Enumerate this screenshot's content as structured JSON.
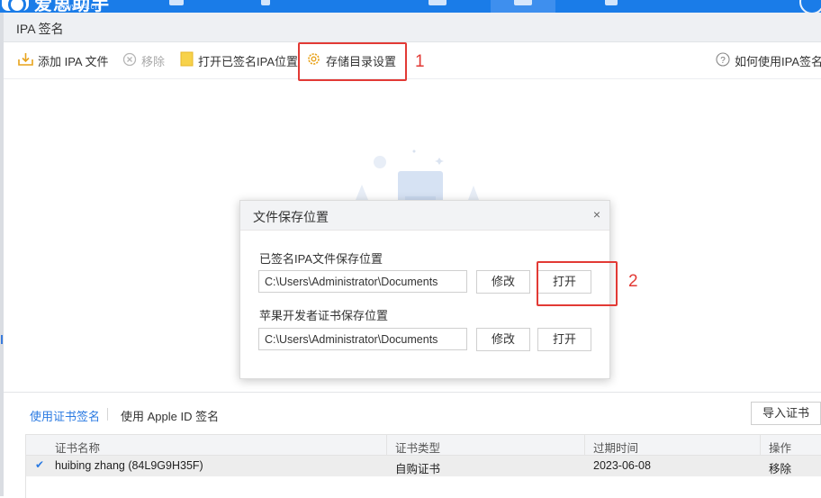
{
  "app": {
    "logo_text": "爱思助手",
    "logo_url": "www.i4.cn",
    "window_title": "IPA 签名"
  },
  "toolbar": {
    "add_ipa": "添加 IPA 文件",
    "remove": "移除",
    "open_signed": "打开已签名IPA位置",
    "storage_settings": "存储目录设置",
    "help": "如何使用IPA签名?"
  },
  "annotations": {
    "marker_1": "1",
    "marker_2": "2"
  },
  "dialog": {
    "title": "文件保存位置",
    "close": "×",
    "signed_ipa": {
      "label": "已签名IPA文件保存位置",
      "path": "C:\\Users\\Administrator\\Documents",
      "modify": "修改",
      "open": "打开"
    },
    "dev_cert": {
      "label": "苹果开发者证书保存位置",
      "path": "C:\\Users\\Administrator\\Documents",
      "modify": "修改",
      "open": "打开"
    }
  },
  "bottom": {
    "tab_cert": "使用证书签名",
    "tab_appleid": "使用 Apple ID 签名",
    "import_cert": "导入证书",
    "columns": [
      "证书名称",
      "证书类型",
      "过期时间",
      "操作"
    ],
    "rows": [
      {
        "checked": true,
        "name": "huibing zhang (84L9G9H35F)",
        "type": "自购证书",
        "expires": "2023-06-08",
        "action": "移除"
      }
    ]
  },
  "colors": {
    "accent": "#1a7ce8",
    "highlight": "#e23a35",
    "link": "#2a7ae2"
  }
}
